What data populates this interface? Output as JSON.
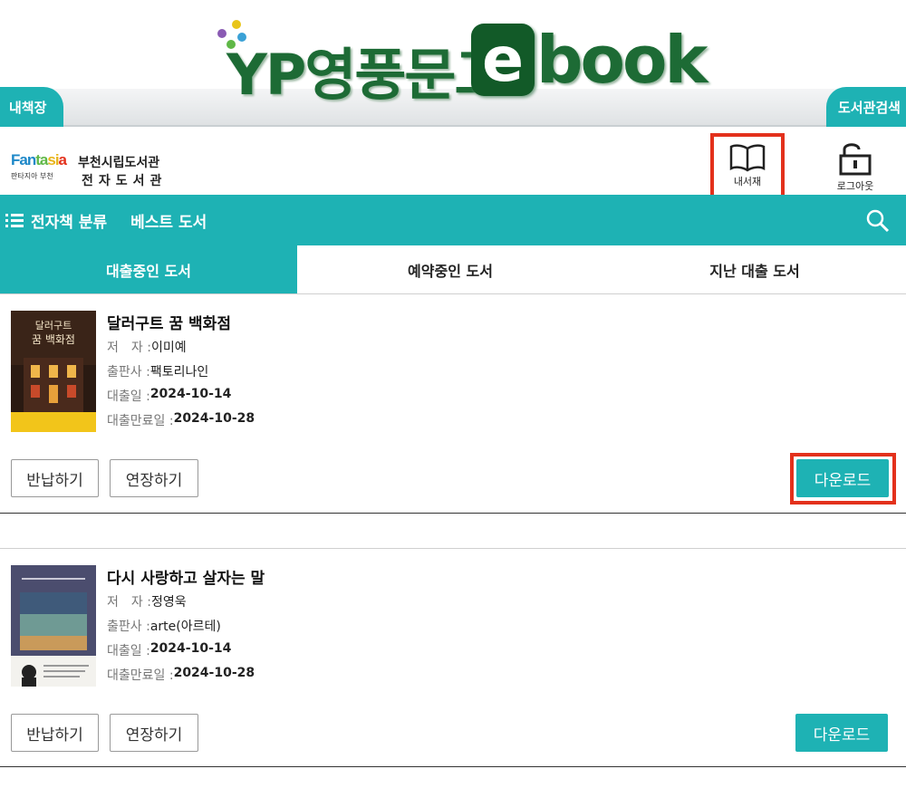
{
  "banner": {
    "left_tab": "내책장",
    "right_tab": "도서관검색",
    "logo_text_main": "YP영풍문고",
    "logo_text_e": "e",
    "logo_text_book": "book"
  },
  "header": {
    "lib_logo_text": "Fantasia",
    "lib_logo_sub": "판타지아 부천",
    "lib_name_line1": "부천시립도서관",
    "lib_name_line2": "전자도서관",
    "mybook_label": "내서재",
    "logout_label": "로그아웃"
  },
  "nav": {
    "category_label": "전자책 분류",
    "best_label": "베스트 도서"
  },
  "tabs": [
    "대출중인 도서",
    "예약중인 도서",
    "지난 대출 도서"
  ],
  "labels": {
    "author": "저　자 : ",
    "publisher": "출판사 : ",
    "loan_date": "대출일 : ",
    "due_date": "대출만료일 : ",
    "return_btn": "반납하기",
    "extend_btn": "연장하기",
    "download_btn": "다운로드"
  },
  "books": [
    {
      "title": "달러구트 꿈 백화점",
      "author": "이미예",
      "publisher": "팩토리나인",
      "loan_date": "2024-10-14",
      "due_date": "2024-10-28",
      "cover_title_a": "달러구트",
      "cover_title_b": "꿈 백화점"
    },
    {
      "title": "다시 사랑하고 살자는 말",
      "author": "정영욱",
      "publisher": "arte(아르테)",
      "loan_date": "2024-10-14",
      "due_date": "2024-10-28"
    }
  ],
  "colors": {
    "teal": "#1eb2b4",
    "highlight_red": "#e3311c",
    "logo_green": "#1d6b35"
  }
}
